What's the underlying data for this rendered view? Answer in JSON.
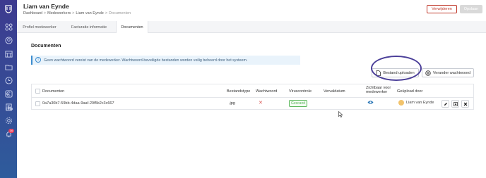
{
  "header": {
    "title": "Liam van Eynde",
    "breadcrumb": [
      "Dashboard",
      "Medewerkers",
      "Liam van Eynde",
      "Documenten"
    ],
    "breadcrumb_sep": ">",
    "delete_label": "Verwijderen",
    "update_label": "Opslaan"
  },
  "tabs": [
    {
      "label": "Profiel medewerker"
    },
    {
      "label": "Facturatie informatie"
    },
    {
      "label": "Documenten"
    }
  ],
  "section": {
    "title": "Documenten",
    "info_icon": "i",
    "info": "Geen wachtwoord vereist van de medewerker. Wachtwoord-beveiligde bestanden worden veilig beheerd door het systeem."
  },
  "actions": {
    "upload_label": "Bestand uploaden",
    "password_label": "Verander wachtwoord"
  },
  "table": {
    "columns": [
      "Documenten",
      "Bestandstype",
      "Wachtwoord",
      "Viruscontrole",
      "Vervaldatum",
      "Zichtbaar voor medewerker",
      "Geüpload door"
    ],
    "rows": [
      {
        "document": "0a7a30b7-59bb-4daa-9aaf-29f5b2c3c667",
        "type": ".jpg",
        "password": "✕",
        "virus": "Gescand",
        "expiry": "",
        "visible_icon": "eye-icon",
        "uploaded_by": "Liam van Eynde",
        "action_icons": [
          "pencil-icon",
          "download-icon",
          "delete-icon"
        ]
      }
    ]
  },
  "colors": {
    "sidebar_top": "#3d3a8f",
    "sidebar_bottom": "#2e5c9c",
    "danger": "#c0392b",
    "info": "#3c8dcf",
    "success": "#5cb85c",
    "highlight": "#4b3f99",
    "eye": "#1f6fb2"
  },
  "sidebar_icons": [
    "grid-icon",
    "user-icon",
    "calendar-icon",
    "folder-icon",
    "clock-icon",
    "euro-icon",
    "document-icon",
    "chart-icon",
    "gear-icon",
    "bell-icon"
  ],
  "notification_count": "16"
}
